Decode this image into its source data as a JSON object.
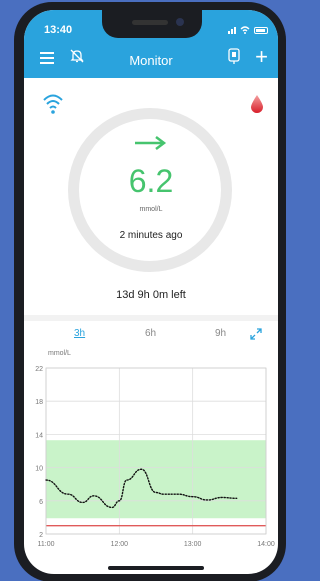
{
  "status_bar": {
    "time": "13:40"
  },
  "header": {
    "title": "Monitor"
  },
  "reading": {
    "value": "6.2",
    "unit": "mmol/L",
    "updated": "2 minutes ago",
    "trend": "steady-right-arrow",
    "sensor_remaining": "13d 9h 0m left"
  },
  "chart": {
    "tabs": [
      {
        "label": "3h",
        "active": true
      },
      {
        "label": "6h",
        "active": false
      },
      {
        "label": "9h",
        "active": false
      }
    ],
    "ylabel": "mmol/L"
  },
  "colors": {
    "header": "#2aa3dd",
    "glucose": "#46c46e",
    "target_band": "#c9f3c9",
    "low_line": "#e05a5a"
  },
  "chart_data": {
    "type": "line",
    "ylabel": "mmol/L",
    "ylim": [
      2,
      22
    ],
    "yticks": [
      2,
      6,
      10,
      14,
      18,
      22
    ],
    "xticks": [
      "11:00",
      "12:00",
      "13:00",
      "14:00"
    ],
    "x_hours": [
      11.0,
      11.3,
      11.5,
      11.65,
      11.9,
      12.0,
      12.1,
      12.3,
      12.5,
      12.6,
      12.8,
      13.0,
      13.2,
      13.4,
      13.6
    ],
    "series": [
      {
        "values": [
          8.5,
          6.8,
          5.8,
          6.6,
          5.2,
          6.0,
          8.5,
          9.8,
          7.0,
          6.8,
          6.8,
          6.5,
          6.1,
          6.4,
          6.3
        ]
      }
    ],
    "target_range": [
      3.9,
      13.3
    ],
    "low_threshold": 3.0,
    "grid": true
  }
}
